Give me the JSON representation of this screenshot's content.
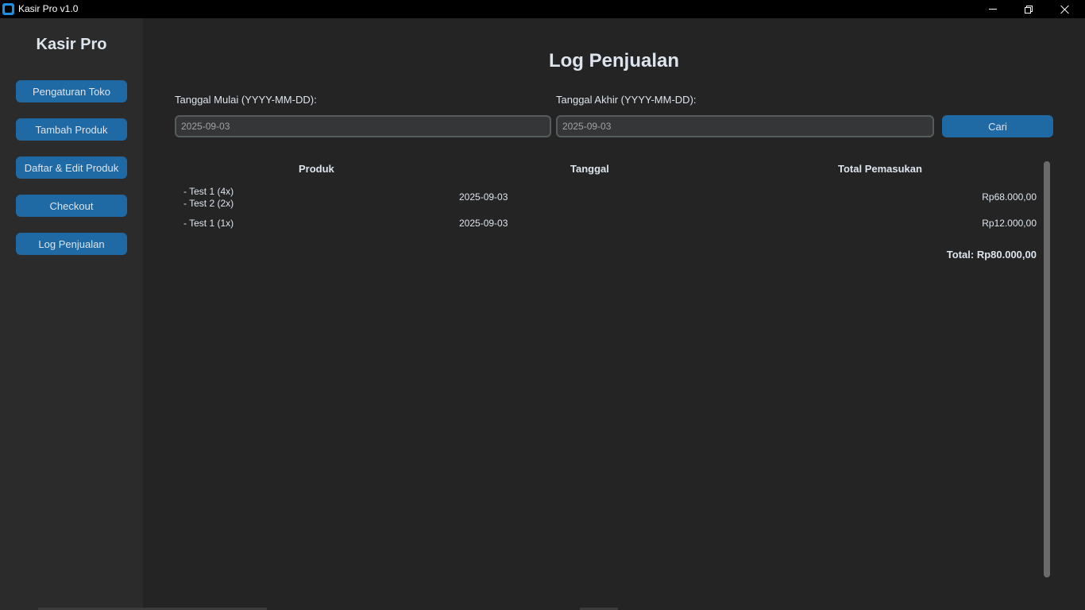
{
  "window": {
    "title": "Kasir Pro v1.0",
    "icon": "app-icon"
  },
  "sidebar": {
    "brand": "Kasir Pro",
    "items": [
      {
        "label": "Pengaturan Toko"
      },
      {
        "label": "Tambah Produk"
      },
      {
        "label": "Daftar & Edit Produk"
      },
      {
        "label": "Checkout"
      },
      {
        "label": "Log Penjualan"
      }
    ]
  },
  "main": {
    "title": "Log Penjualan",
    "start_date": {
      "label": "Tanggal Mulai (YYYY-MM-DD):",
      "value": "2025-09-03"
    },
    "end_date": {
      "label": "Tanggal Akhir (YYYY-MM-DD):",
      "value": "2025-09-03"
    },
    "search_label": "Cari",
    "table": {
      "headers": [
        "Produk",
        "Tanggal",
        "Total Pemasukan"
      ],
      "rows": [
        {
          "products": [
            "- Test 1 (4x)",
            "- Test 2 (2x)"
          ],
          "date": "2025-09-03",
          "total": "Rp68.000,00"
        },
        {
          "products": [
            "- Test 1 (1x)"
          ],
          "date": "2025-09-03",
          "total": "Rp12.000,00"
        }
      ],
      "grand_total": "Total: Rp80.000,00"
    }
  },
  "colors": {
    "accent": "#1f6aa5",
    "background": "#242424",
    "sidebar": "#2b2b2b",
    "titlebar": "#000000"
  }
}
